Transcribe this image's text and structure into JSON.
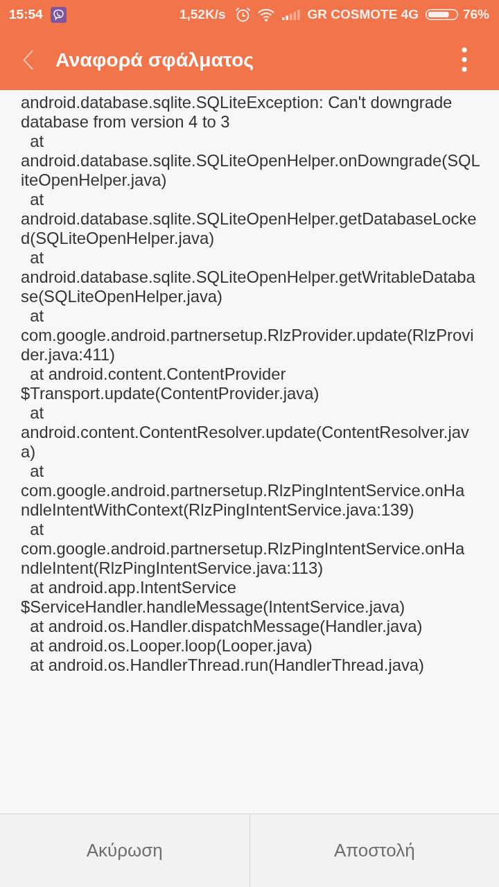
{
  "status_bar": {
    "time": "15:54",
    "network_speed": "1,52K/s",
    "carrier": "GR COSMOTE 4G",
    "battery_percent": "76%"
  },
  "toolbar": {
    "title": "Αναφορά σφάλματος"
  },
  "report": {
    "lines": [
      "android.database.sqlite.SQLiteException: Can't downgrade",
      "database from version 4 to 3",
      "  at",
      "android.database.sqlite.SQLiteOpenHelper.onDowngrade(SQL",
      "iteOpenHelper.java)",
      "  at",
      "android.database.sqlite.SQLiteOpenHelper.getDatabaseLocke",
      "d(SQLiteOpenHelper.java)",
      "  at",
      "android.database.sqlite.SQLiteOpenHelper.getWritableDataba",
      "se(SQLiteOpenHelper.java)",
      "  at",
      "com.google.android.partnersetup.RlzProvider.update(RlzProvi",
      "der.java:411)",
      "  at android.content.ContentProvider",
      "$Transport.update(ContentProvider.java)",
      "  at",
      "android.content.ContentResolver.update(ContentResolver.jav",
      "a)",
      "  at",
      "com.google.android.partnersetup.RlzPingIntentService.onHa",
      "ndleIntentWithContext(RlzPingIntentService.java:139)",
      "  at",
      "com.google.android.partnersetup.RlzPingIntentService.onHa",
      "ndleIntent(RlzPingIntentService.java:113)",
      "  at android.app.IntentService",
      "$ServiceHandler.handleMessage(IntentService.java)",
      "  at android.os.Handler.dispatchMessage(Handler.java)",
      "  at android.os.Looper.loop(Looper.java)",
      "  at android.os.HandlerThread.run(HandlerThread.java)"
    ]
  },
  "actions": [
    "Ακύρωση",
    "Αποστολή"
  ]
}
